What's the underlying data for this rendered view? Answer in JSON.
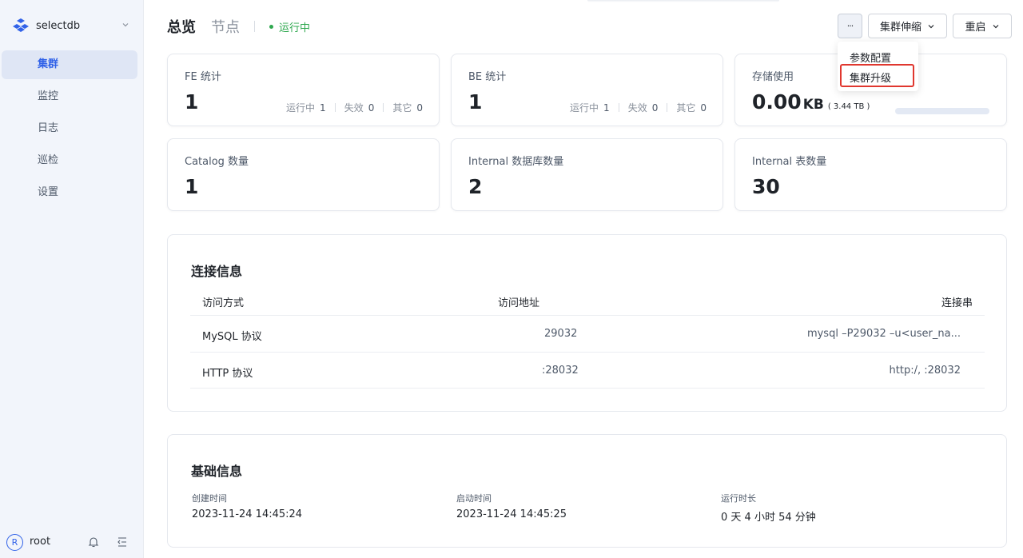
{
  "sidebar": {
    "brand": "selectdb",
    "items": [
      {
        "label": "集群",
        "active": true
      },
      {
        "label": "监控",
        "active": false
      },
      {
        "label": "日志",
        "active": false
      },
      {
        "label": "巡检",
        "active": false
      },
      {
        "label": "设置",
        "active": false
      }
    ],
    "user": {
      "initial": "R",
      "name": "root"
    }
  },
  "header": {
    "tabs": [
      "总览",
      "节点"
    ],
    "status": "运行中",
    "status_color": "#2fa84f",
    "more_label": "···",
    "scale_label": "集群伸缩",
    "restart_label": "重启",
    "dropdown": [
      "参数配置",
      "集群升级"
    ]
  },
  "stats": {
    "fe": {
      "label": "FE 统计",
      "value": "1",
      "running_label": "运行中",
      "running": "1",
      "failed_label": "失效",
      "failed": "0",
      "other_label": "其它",
      "other": "0"
    },
    "be": {
      "label": "BE 统计",
      "value": "1",
      "running_label": "运行中",
      "running": "1",
      "failed_label": "失效",
      "failed": "0",
      "other_label": "其它",
      "other": "0"
    },
    "storage": {
      "label": "存储使用",
      "value": "0.00",
      "unit": "KB",
      "total": "( 3.44 TB )",
      "usage_fraction": 0
    },
    "catalog": {
      "label": "Catalog 数量",
      "value": "1"
    },
    "database": {
      "label": "Internal 数据库数量",
      "value": "2"
    },
    "table": {
      "label": "Internal 表数量",
      "value": "30"
    }
  },
  "connection": {
    "title": "连接信息",
    "headers": [
      "访问方式",
      "访问地址",
      "连接串"
    ],
    "rows": [
      {
        "method": "MySQL 协议",
        "address": "29032",
        "conn": "mysql –P29032 –u<user_na..."
      },
      {
        "method": "HTTP 协议",
        "address": ":28032",
        "conn": "http:/, :28032"
      }
    ]
  },
  "basic": {
    "title": "基础信息",
    "created_label": "创建时间",
    "created": "2023-11-24 14:45:24",
    "started_label": "启动时间",
    "started": "2023-11-24 14:45:25",
    "uptime_label": "运行时长",
    "uptime": "0 天 4 小时 54 分钟"
  },
  "colors": {
    "accent": "#3162e8",
    "highlight": "#e0372f"
  }
}
